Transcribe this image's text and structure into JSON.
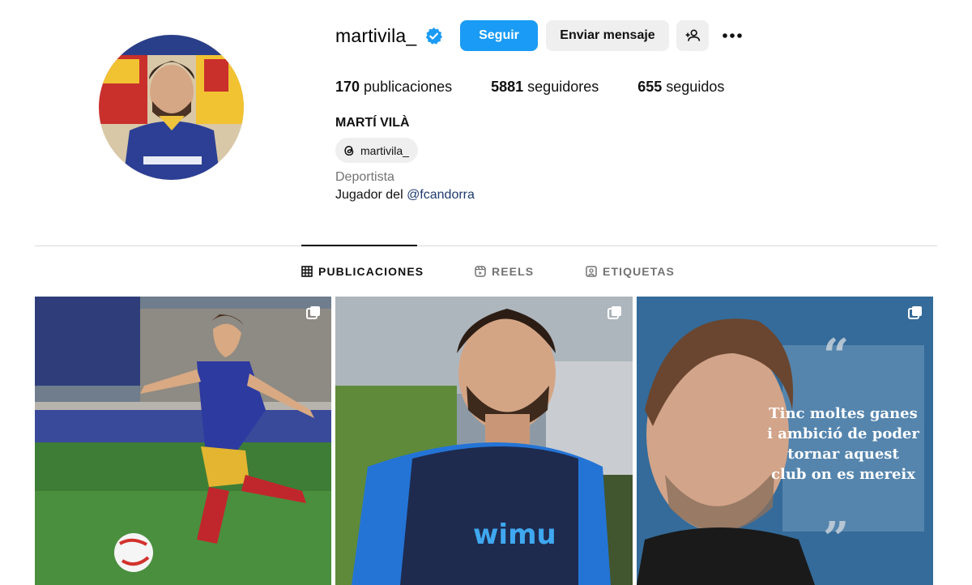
{
  "profile": {
    "username": "martivila_",
    "verified": true,
    "full_name": "MARTÍ VILÀ",
    "threads_handle": "martivila_",
    "category": "Deportista",
    "bio_prefix": "Jugador del ",
    "bio_mention": "@fcandorra"
  },
  "actions": {
    "follow_label": "Seguir",
    "message_label": "Enviar mensaje",
    "add_user_icon": "add-user-icon",
    "more_icon": "more-options-icon"
  },
  "stats": {
    "posts_count": "170",
    "posts_label": " publicaciones",
    "followers_count": "5881",
    "followers_label": " seguidores",
    "following_count": "655",
    "following_label": " seguidos"
  },
  "tabs": [
    {
      "label": "PUBLICACIONES",
      "icon": "grid-icon",
      "active": true
    },
    {
      "label": "REELS",
      "icon": "reels-icon",
      "active": false
    },
    {
      "label": "ETIQUETAS",
      "icon": "tagged-icon",
      "active": false
    }
  ],
  "posts": [
    {
      "type": "carousel",
      "icon": "multiple-photos-icon"
    },
    {
      "type": "carousel",
      "icon": "multiple-photos-icon"
    },
    {
      "type": "carousel",
      "icon": "multiple-photos-icon",
      "overlay_text": "Tinc moltes ganes\ni ambició de poder\ntornar aquest\nclub on es mereix"
    }
  ],
  "colors": {
    "accent": "#1a9bf5",
    "secondary_button": "#efefef",
    "muted_text": "#737373",
    "mention_link": "#1e3a6e",
    "divider": "#dbdbdb"
  }
}
